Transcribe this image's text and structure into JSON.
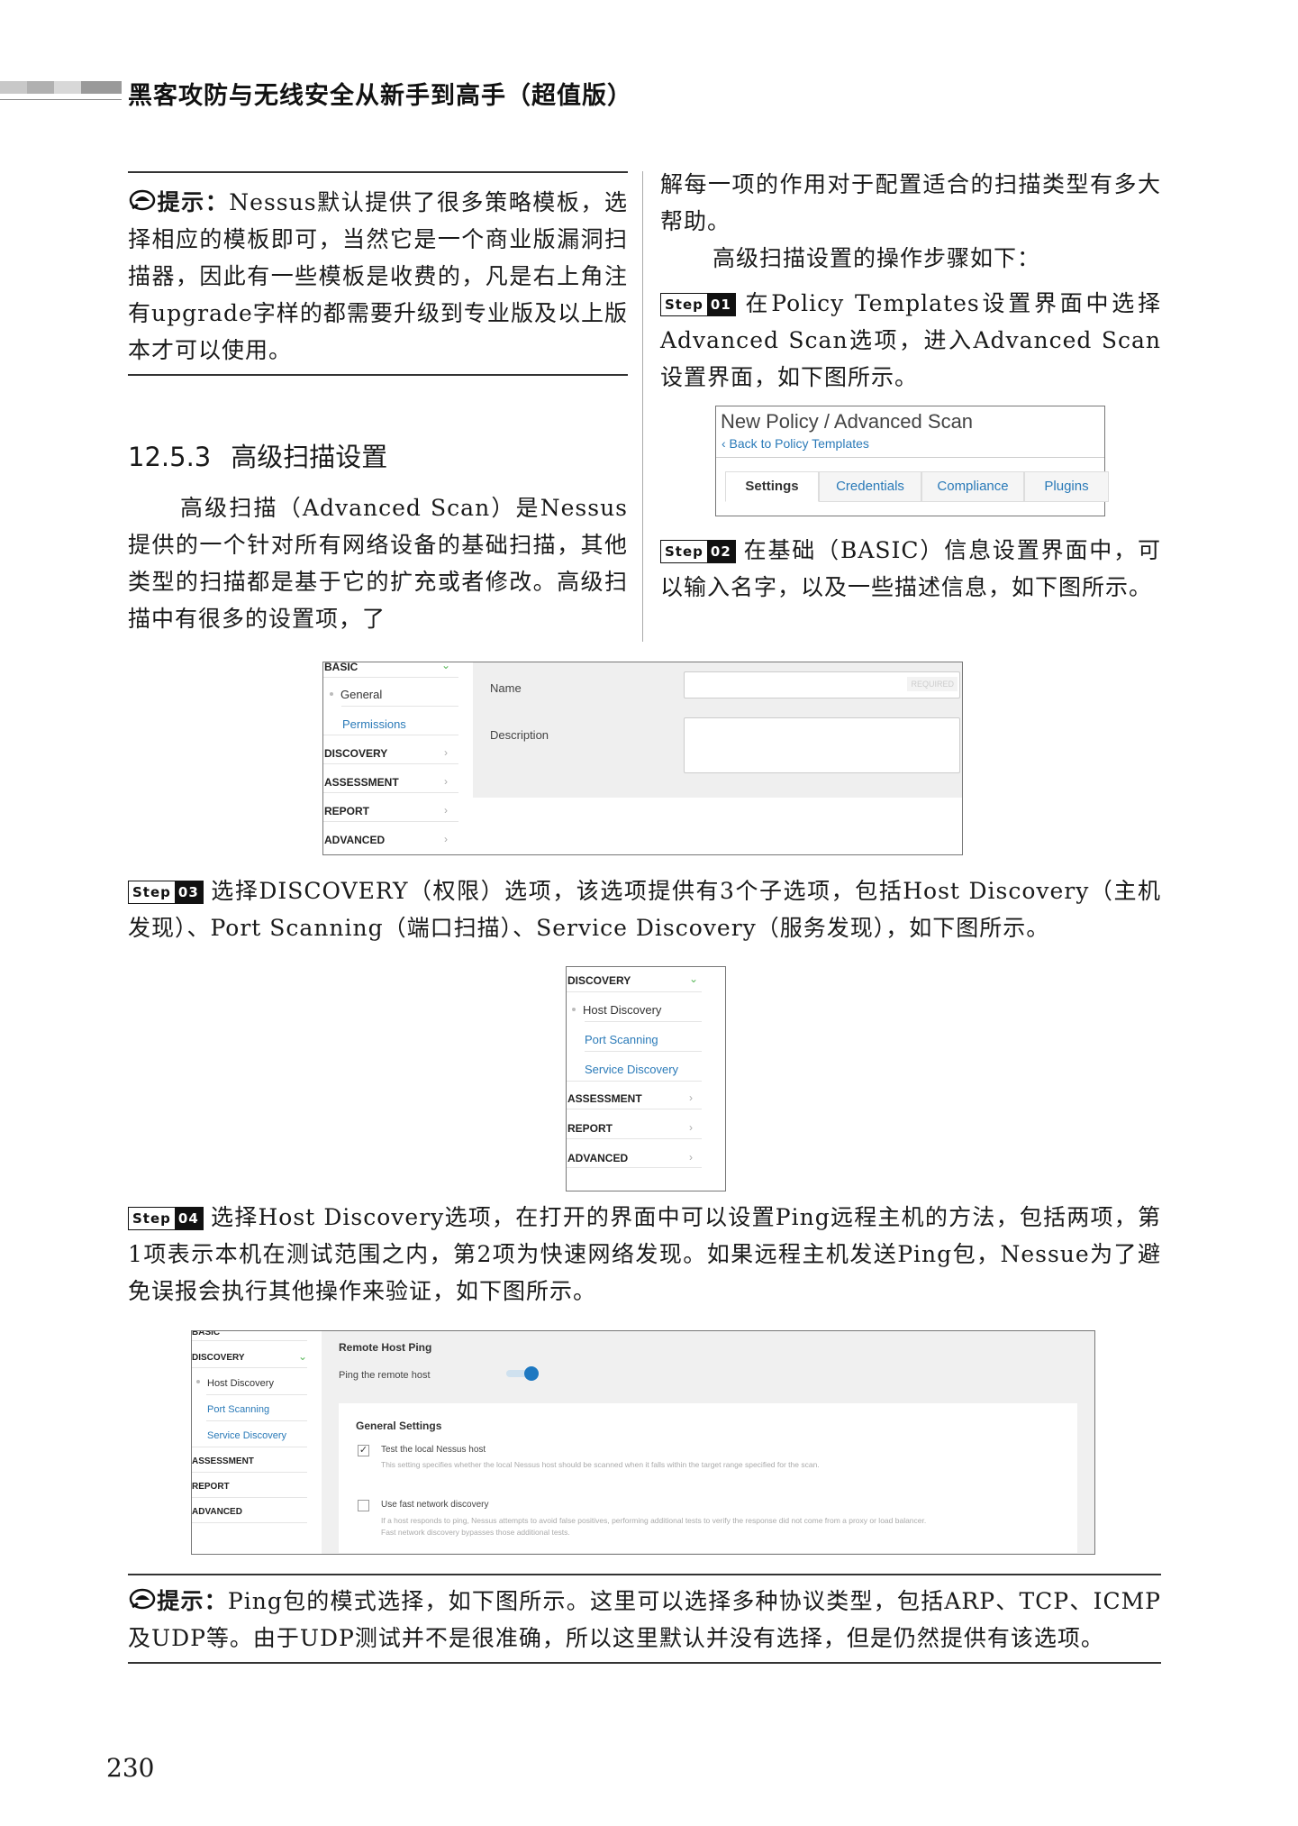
{
  "header": {
    "title": "黑客攻防与无线安全从新手到高手（超值版）"
  },
  "tip1": {
    "label": "提示：",
    "text": "Nessus默认提供了很多策略模板，选择相应的模板即可，当然它是一个商业版漏洞扫描器，因此有一些模板是收费的，凡是右上角注有upgrade字样的都需要升级到专业版及以上版本才可以使用。"
  },
  "section": {
    "number": "12.5.3",
    "title": "高级扫描设置"
  },
  "intro": "高级扫描（Advanced Scan）是Nessus提供的一个针对所有网络设备的基础扫描，其他类型的扫描都是基于它的扩充或者修改。高级扫描中有很多的设置项，了",
  "right_col": {
    "para1": "解每一项的作用对于配置适合的扫描类型有多大帮助。",
    "para2": "高级扫描设置的操作步骤如下：",
    "step01_text": "在Policy Templates设置界面中选择Advanced Scan选项，进入Advanced Scan设置界面，如下图所示。",
    "step02_text": "在基础（BASIC）信息设置界面中，可以输入名字，以及一些描述信息，如下图所示。"
  },
  "step_word": "Step",
  "steps": {
    "s01": "01",
    "s02": "02",
    "s03": "03",
    "s04": "04"
  },
  "shot1": {
    "title": "New Policy / Advanced Scan",
    "back": "‹ Back to Policy Templates",
    "tabs": [
      "Settings",
      "Credentials",
      "Compliance",
      "Plugins"
    ]
  },
  "shot2": {
    "basic": "BASIC",
    "general": "General",
    "permissions": "Permissions",
    "discovery": "DISCOVERY",
    "assessment": "ASSESSMENT",
    "report": "REPORT",
    "advanced": "ADVANCED",
    "name_label": "Name",
    "desc_label": "Description",
    "required": "REQUIRED"
  },
  "step03_text": "选择DISCOVERY（权限）选项，该选项提供有3个子选项，包括Host Discovery（主机发现）、Port Scanning（端口扫描）、Service Discovery（服务发现），如下图所示。",
  "shot3": {
    "discovery": "DISCOVERY",
    "host": "Host Discovery",
    "port": "Port Scanning",
    "service": "Service Discovery",
    "assessment": "ASSESSMENT",
    "report": "REPORT",
    "advanced": "ADVANCED"
  },
  "step04_text": "选择Host Discovery选项，在打开的界面中可以设置Ping远程主机的方法，包括两项，第1项表示本机在测试范围之内，第2项为快速网络发现。如果远程主机发送Ping包，Nessue为了避免误报会执行其他操作来验证，如下图所示。",
  "shot4": {
    "basic": "BASIC",
    "discovery": "DISCOVERY",
    "host": "Host Discovery",
    "port": "Port Scanning",
    "service": "Service Discovery",
    "assessment": "ASSESSMENT",
    "report": "REPORT",
    "advanced": "ADVANCED",
    "remote_title": "Remote Host Ping",
    "ping_label": "Ping the remote host",
    "general_title": "General Settings",
    "opt1_label": "Test the local Nessus host",
    "opt1_desc": "This setting specifies whether the local Nessus host should be scanned when it falls within the target range specified for the scan.",
    "opt2_label": "Use fast network discovery",
    "opt2_desc1": "If a host responds to ping, Nessus attempts to avoid false positives, performing additional tests to verify the response did not come from a proxy or load balancer.",
    "opt2_desc2": "Fast network discovery bypasses those additional tests."
  },
  "tip2": {
    "label": "提示：",
    "text": "Ping包的模式选择，如下图所示。这里可以选择多种协议类型，包括ARP、TCP、ICMP及UDP等。由于UDP测试并不是很准确，所以这里默认并没有选择，但是仍然提供有该选项。"
  },
  "page_number": "230"
}
